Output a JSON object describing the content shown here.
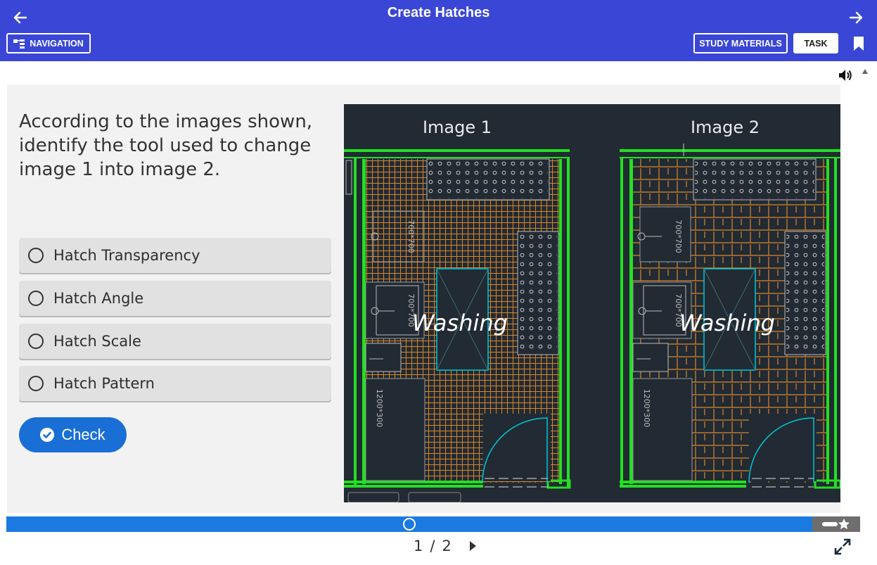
{
  "header": {
    "title": "Create Hatches",
    "navigation_label": "NAVIGATION",
    "study_materials_label": "STUDY MATERIALS",
    "task_label": "TASK"
  },
  "question": {
    "text": "According to the images shown, identify the tool used to change image 1 into image 2.",
    "options": [
      {
        "label": "Hatch Transparency"
      },
      {
        "label": "Hatch Angle"
      },
      {
        "label": "Hatch Scale"
      },
      {
        "label": "Hatch Pattern"
      }
    ],
    "check_label": "Check"
  },
  "figure": {
    "image1_title": "Image 1",
    "image2_title": "Image 2",
    "room_label": "Washing",
    "dim_a": "700*700",
    "dim_b": "700*700",
    "dim_c": "1200*300"
  },
  "pager": {
    "current": "1",
    "separator": "/",
    "total": "2"
  },
  "progress": {
    "fraction": 0.5
  },
  "colors": {
    "header_bg": "#3a46d6",
    "accent": "#1a6fd6",
    "progress": "#1a7ae0",
    "cad_bg": "#222a33",
    "wall": "#22e022",
    "hatch": "#d8862a",
    "fixture": "#00c8d8"
  },
  "icons": [
    "arrow-left-icon",
    "arrow-right-icon",
    "navigation-icon",
    "bookmark-icon",
    "sound-icon",
    "check-circle-icon",
    "next-page-icon",
    "fullscreen-icon",
    "star-icon"
  ]
}
